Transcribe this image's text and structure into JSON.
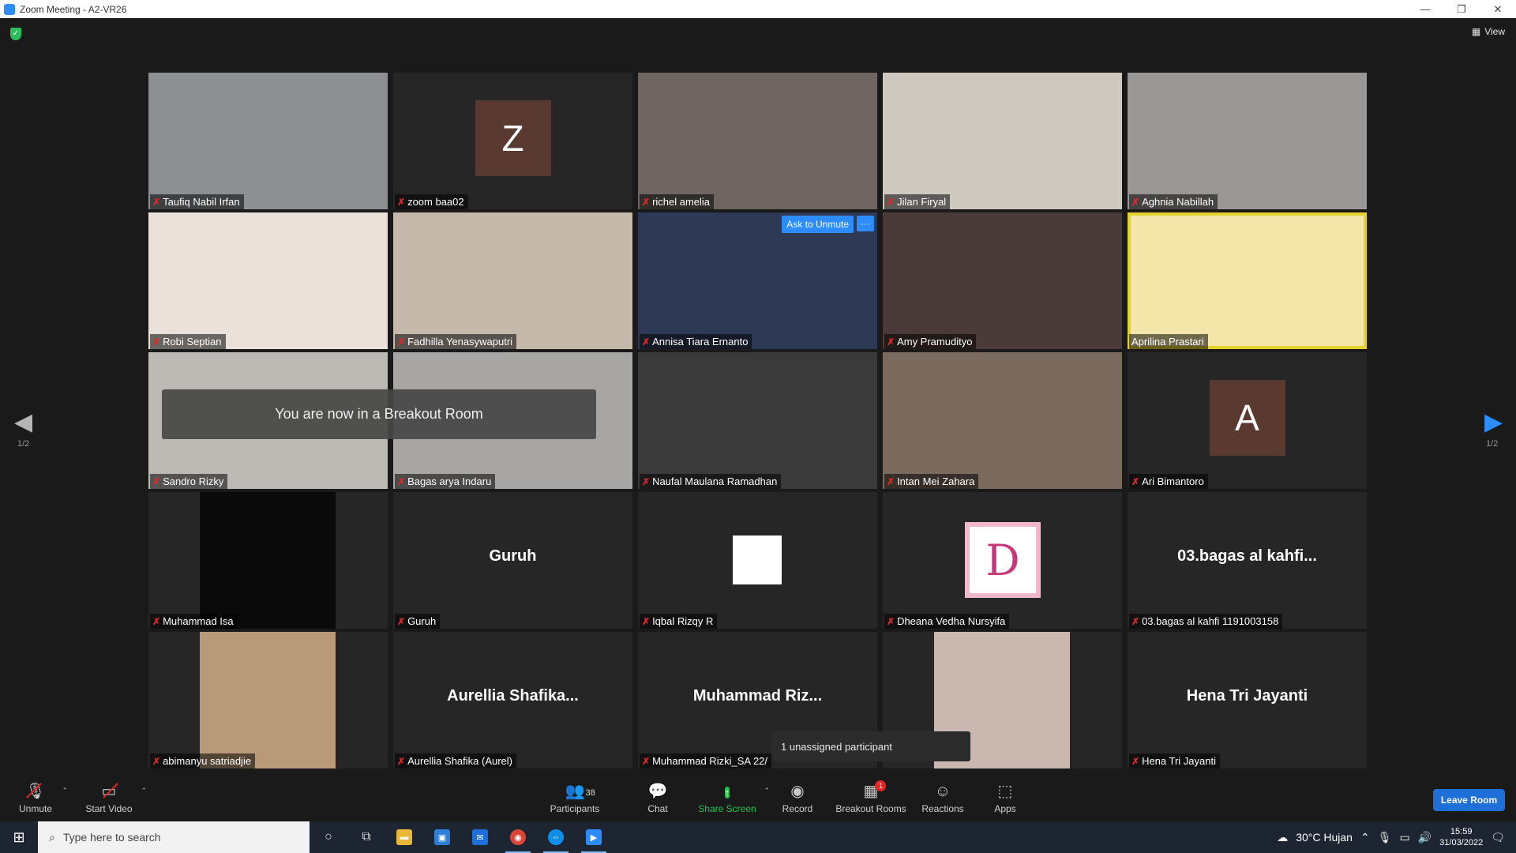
{
  "window": {
    "title": "Zoom Meeting - A2-VR26",
    "minimize": "—",
    "restore": "❐",
    "close": "✕"
  },
  "header": {
    "view_label": "View",
    "shield": "✓"
  },
  "tiles": [
    {
      "name": "Taufiq Nabil Irfan",
      "kind": "video",
      "bg": "#8d8f92"
    },
    {
      "name": "zoom baa02",
      "kind": "letter",
      "letter": "Z"
    },
    {
      "name": "richel amelia",
      "kind": "video",
      "bg": "#6e6560"
    },
    {
      "name": "Jilan Firyal",
      "kind": "video",
      "bg": "#cfc8c0"
    },
    {
      "name": "Aghnia Nabillah",
      "kind": "video",
      "bg": "#9a9896"
    },
    {
      "name": "Robi Septian",
      "kind": "video",
      "bg": "#e9e1da"
    },
    {
      "name": "Fadhilla Yenasywaputri",
      "kind": "video",
      "bg": "#c4b9ab"
    },
    {
      "name": "Annisa Tiara Ernanto",
      "kind": "video",
      "bg": "#2e3a55"
    },
    {
      "name": "Amy Pramudityo",
      "kind": "video",
      "bg": "#4a3a38"
    },
    {
      "name": "Aprilina Prastari",
      "kind": "video",
      "bg": "#f3e6a8",
      "active": true
    },
    {
      "name": "Sandro Rizky",
      "kind": "video",
      "bg": "#bdbab6"
    },
    {
      "name": "Bagas arya Indaru",
      "kind": "video",
      "bg": "#a8a6a4"
    },
    {
      "name": "Naufal Maulana Ramadhan",
      "kind": "video",
      "bg": "#3a3a3a"
    },
    {
      "name": "Intan Mei Zahara",
      "kind": "video",
      "bg": "#7b6a5e"
    },
    {
      "name": "Ari Bimantoro",
      "kind": "letter",
      "letter": "A"
    },
    {
      "name": "Muhammad Isa",
      "kind": "frame",
      "bg": "#0a0a0a"
    },
    {
      "name": "Guruh",
      "kind": "text",
      "big": "Guruh"
    },
    {
      "name": "Iqbal Rizqy R",
      "kind": "whitebox"
    },
    {
      "name": "Dheana Vedha Nursyifa",
      "kind": "dletter",
      "letter": "D"
    },
    {
      "name": "03.bagas al kahfi 1191003158",
      "kind": "text",
      "big": "03.bagas al kahfi..."
    },
    {
      "name": "abimanyu satriadjie",
      "kind": "frame",
      "bg": "#b89a78"
    },
    {
      "name": "Aurellia Shafika (Aurel)",
      "kind": "text",
      "big": "Aurellia  Shafika..."
    },
    {
      "name": "Muhammad Rizki_SA 22/",
      "kind": "text",
      "big": "Muhammad  Riz..."
    },
    {
      "name": "",
      "kind": "frame",
      "bg": "#c9b7b0"
    },
    {
      "name": "Hena Tri Jayanti",
      "kind": "text",
      "big": "Hena Tri Jayanti"
    }
  ],
  "overlays": {
    "ask_unmute": "Ask to Unmute",
    "more": "···",
    "breakout_toast": "You are now in a Breakout Room",
    "unassigned": "1 unassigned participant"
  },
  "pagination": {
    "left": "1/2",
    "right": "1/2"
  },
  "toolbar": {
    "unmute": "Unmute",
    "start_video": "Start Video",
    "participants": "Participants",
    "participants_count": "38",
    "chat": "Chat",
    "share_screen": "Share Screen",
    "record": "Record",
    "breakout_rooms": "Breakout Rooms",
    "breakout_badge": "1",
    "reactions": "Reactions",
    "apps": "Apps",
    "leave_room": "Leave Room"
  },
  "taskbar": {
    "search_placeholder": "Type here to search",
    "weather": "30°C  Hujan",
    "time": "15:59",
    "date": "31/03/2022"
  },
  "colors": {
    "accent": "#2d8cff",
    "active_speaker": "#e6d12f",
    "muted": "#e02828",
    "share_green": "#26c14a"
  }
}
